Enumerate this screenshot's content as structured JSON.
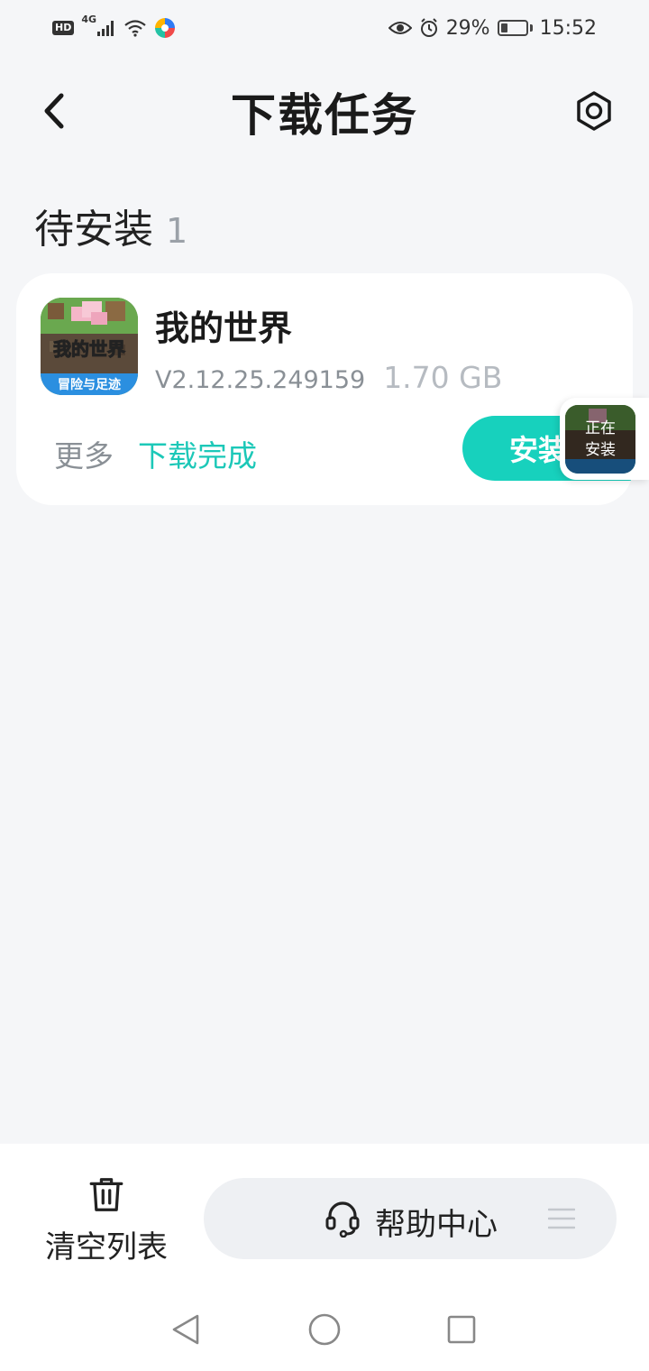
{
  "status_bar": {
    "hd": "HD",
    "network": "4G",
    "battery_percent": "29%",
    "time": "15:52",
    "battery_level": 0.29
  },
  "header": {
    "title": "下载任务"
  },
  "section": {
    "title": "待安装",
    "count": "1"
  },
  "task": {
    "app_name": "我的世界",
    "version": "V2.12.25.249159",
    "size": "1.70 GB",
    "more_label": "更多",
    "status": "下载完成",
    "install_label": "安装",
    "icon_text_main": "我的世界",
    "icon_text_sub": "冒险与足迹"
  },
  "float_widget": {
    "line1": "正在",
    "line2": "安装"
  },
  "bottom_bar": {
    "clear_label": "清空列表",
    "help_label": "帮助中心"
  },
  "colors": {
    "accent": "#17d1bd",
    "background": "#f5f6f8"
  }
}
